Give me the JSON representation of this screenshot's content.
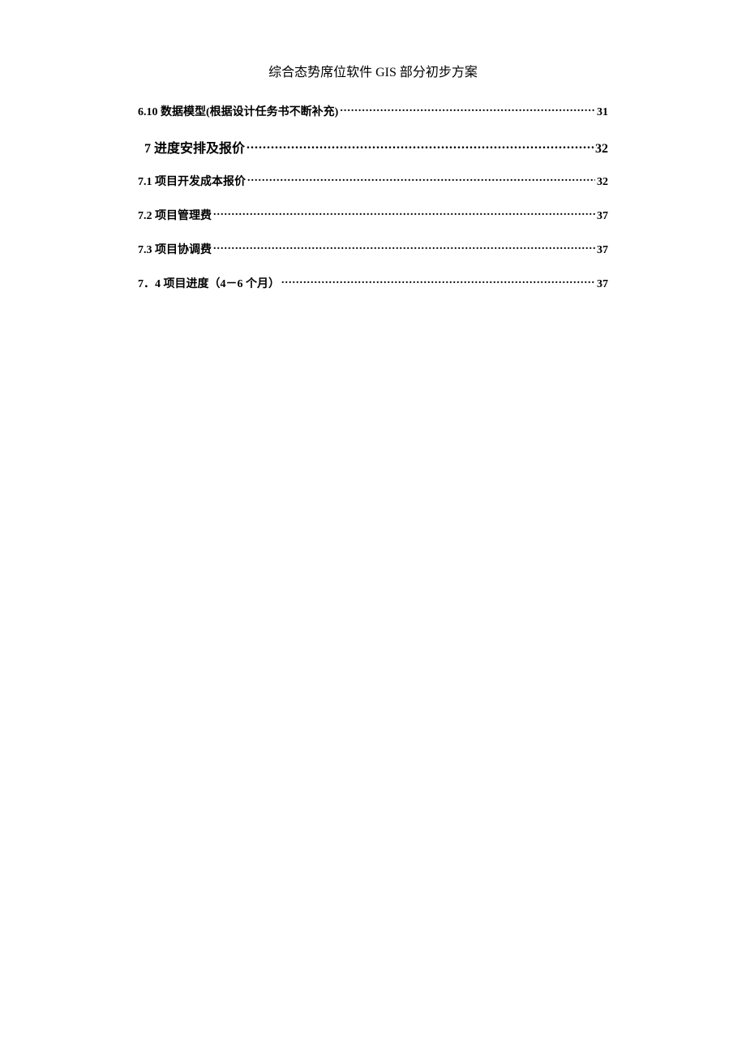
{
  "header": {
    "title": "综合态势席位软件 GIS 部分初步方案"
  },
  "toc": [
    {
      "level": 2,
      "label": "6.10 数据模型(根据设计任务书不断补充)",
      "page": "31"
    },
    {
      "level": 1,
      "label": "7 进度安排及报价",
      "page": "32"
    },
    {
      "level": 2,
      "label": "7.1 项目开发成本报价",
      "page": "32"
    },
    {
      "level": 2,
      "label": "7.2 项目管理费",
      "page": "37"
    },
    {
      "level": 2,
      "label": "7.3 项目协调费",
      "page": "37"
    },
    {
      "level": 2,
      "label": "7．4 项目进度（4－6 个月）",
      "page": "37"
    }
  ]
}
